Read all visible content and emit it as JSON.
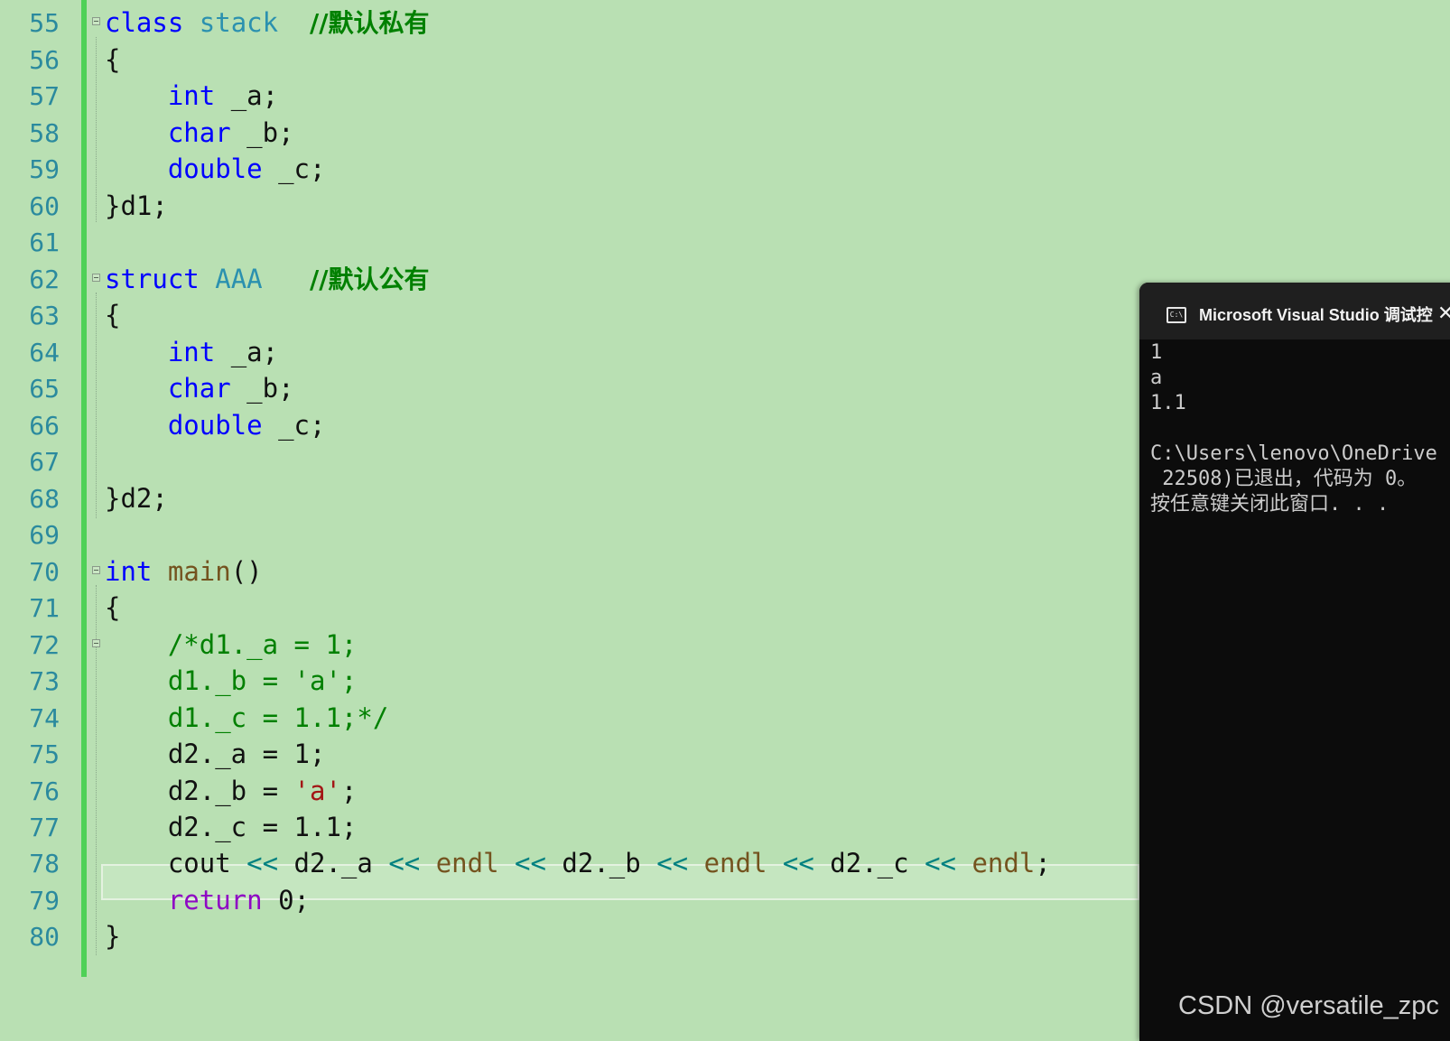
{
  "editor": {
    "lines": [
      {
        "n": "55"
      },
      {
        "n": "56"
      },
      {
        "n": "57"
      },
      {
        "n": "58"
      },
      {
        "n": "59"
      },
      {
        "n": "60"
      },
      {
        "n": "61"
      },
      {
        "n": "62"
      },
      {
        "n": "63"
      },
      {
        "n": "64"
      },
      {
        "n": "65"
      },
      {
        "n": "66"
      },
      {
        "n": "67"
      },
      {
        "n": "68"
      },
      {
        "n": "69"
      },
      {
        "n": "70"
      },
      {
        "n": "71"
      },
      {
        "n": "72"
      },
      {
        "n": "73"
      },
      {
        "n": "74"
      },
      {
        "n": "75"
      },
      {
        "n": "76"
      },
      {
        "n": "77"
      },
      {
        "n": "78"
      },
      {
        "n": "79"
      },
      {
        "n": "80"
      }
    ],
    "tokens": {
      "l55_kw": "class",
      "l55_typ": "stack",
      "l55_cmt": "//默认私有",
      "brace_open": "{",
      "brace_close": "}",
      "int": "int",
      "char": "char",
      "double": "double",
      "var_a": " _a;",
      "var_b": " _b;",
      "var_c": " _c;",
      "l60_tail": "d1;",
      "l62_kw": "struct",
      "l62_typ": "AAA",
      "l62_cmt": "//默认公有",
      "l68_tail": "d2;",
      "l70_fn": "main",
      "l70_paren": "()",
      "l72_cmt": "/*d1._a = 1;",
      "l73_cmt": "d1._b = 'a';",
      "l74_cmt": "d1._c = 1.1;*/",
      "l75": "d2._a = 1;",
      "l76_a": "d2._b = ",
      "l76_str": "'a'",
      "l76_b": ";",
      "l77": "d2._c = 1.1;",
      "l78_cout": "cout",
      "l78_op": "<<",
      "l78_d2a": "d2._a",
      "l78_endl": "endl",
      "l78_d2b": "d2._b",
      "l78_d2c": "d2._c",
      "l78_semi": ";",
      "l79_kw": "return",
      "l79_tail": " 0;"
    }
  },
  "console": {
    "title": "Microsoft Visual Studio 调试控",
    "icon": "console-app-icon",
    "icon_text": "C:\\",
    "close_label": "✕",
    "output": [
      "1",
      "a",
      "1.1",
      "",
      "C:\\Users\\lenovo\\OneDrive",
      " 22508)已退出，代码为 0。",
      "按任意键关闭此窗口. . ."
    ]
  },
  "watermark": "CSDN @versatile_zpc"
}
